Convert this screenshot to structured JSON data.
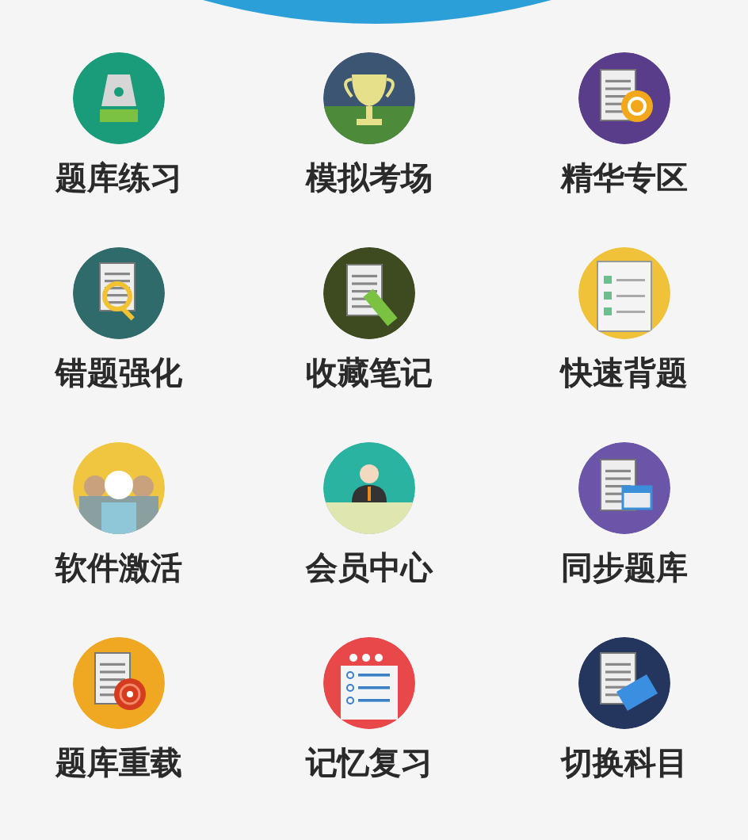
{
  "menu": [
    {
      "label": "题库练习",
      "kind": "pen"
    },
    {
      "label": "模拟考场",
      "kind": "trophy"
    },
    {
      "label": "精华专区",
      "kind": "question"
    },
    {
      "label": "错题强化",
      "kind": "magnifier"
    },
    {
      "label": "收藏笔记",
      "kind": "note"
    },
    {
      "label": "快速背题",
      "kind": "checklist"
    },
    {
      "label": "软件激活",
      "kind": "people"
    },
    {
      "label": "会员中心",
      "kind": "member"
    },
    {
      "label": "同步题库",
      "kind": "calendar"
    },
    {
      "label": "题库重载",
      "kind": "target"
    },
    {
      "label": "记忆复习",
      "kind": "planner"
    },
    {
      "label": "切换科目",
      "kind": "keyboard"
    }
  ]
}
